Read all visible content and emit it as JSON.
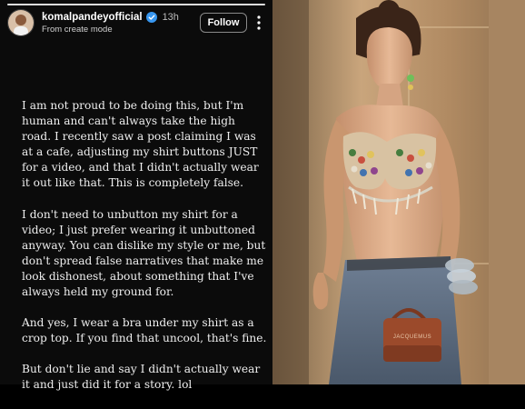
{
  "story": {
    "progress_fraction": 1.0,
    "username": "komalpandeyofficial",
    "time_ago": "13h",
    "subtitle": "From create mode",
    "follow_label": "Follow",
    "paragraphs": [
      "I am not proud to be doing this, but I'm human and can't always take the high road. I recently saw a post claiming I was at a cafe, adjusting my shirt buttons JUST for a video, and that I didn't actually wear it out like that. This is completely false.",
      "I don't need to unbutton my shirt for a video; I just prefer wearing it unbuttoned anyway. You can dislike my style or me, but don't spread false narratives that make me look dishonest, about something that I've always held my ground for.",
      "And yes, I wear a bra under my shirt as a crop top. If you find that uncool, that's fine.",
      "But don't lie and say I didn't actually wear it and just did it for a story. lol"
    ]
  },
  "photo": {
    "bag_label": "JACQUEMUS"
  },
  "icons": {
    "verified": "verified-badge-icon",
    "more": "more-vertical-icon"
  },
  "colors": {
    "story_bg": "#0b0b0b",
    "verified_blue": "#3897f0",
    "bag_brown": "#9b4a2b",
    "wall": "#c9a57c"
  }
}
